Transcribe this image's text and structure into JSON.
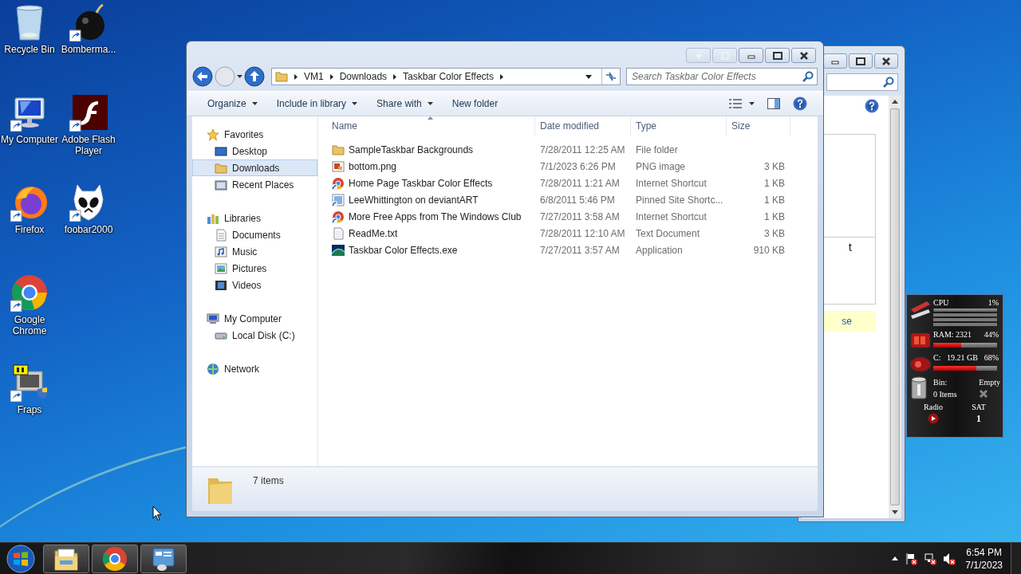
{
  "desktop_icons": [
    {
      "label": "Recycle Bin",
      "kind": "recycle"
    },
    {
      "label": "My Computer",
      "kind": "computer"
    },
    {
      "label": "Firefox",
      "kind": "firefox"
    },
    {
      "label": "Google Chrome",
      "kind": "chrome"
    },
    {
      "label": "Fraps",
      "kind": "fraps"
    },
    {
      "label": "Bomberma...",
      "kind": "bomb"
    },
    {
      "label": "Adobe Flash Player",
      "kind": "flash"
    },
    {
      "label": "foobar2000",
      "kind": "foobar"
    }
  ],
  "back_window": {
    "panel_text": "t",
    "notice_text": "se"
  },
  "explorer": {
    "breadcrumb": [
      "VM1",
      "Downloads",
      "Taskbar Color Effects"
    ],
    "search": {
      "placeholder": "Search Taskbar Color Effects"
    },
    "toolbar": [
      {
        "label": "Organize",
        "dropdown": true
      },
      {
        "label": "Include in library",
        "dropdown": true
      },
      {
        "label": "Share with",
        "dropdown": true
      },
      {
        "label": "New folder",
        "dropdown": false
      }
    ],
    "sidebar": [
      {
        "label": "Favorites",
        "kind": "star",
        "selected": false,
        "children": [
          {
            "label": "Desktop",
            "kind": "desktop",
            "selected": false
          },
          {
            "label": "Downloads",
            "kind": "downloads",
            "selected": true
          },
          {
            "label": "Recent Places",
            "kind": "recent",
            "selected": false
          }
        ]
      },
      {
        "label": "Libraries",
        "kind": "libraries",
        "selected": false,
        "children": [
          {
            "label": "Documents",
            "kind": "documents",
            "selected": false
          },
          {
            "label": "Music",
            "kind": "music",
            "selected": false
          },
          {
            "label": "Pictures",
            "kind": "pictures",
            "selected": false
          },
          {
            "label": "Videos",
            "kind": "videos",
            "selected": false
          }
        ]
      },
      {
        "label": "My Computer",
        "kind": "computer",
        "selected": false,
        "children": [
          {
            "label": "Local Disk (C:)",
            "kind": "disk",
            "selected": false
          }
        ]
      },
      {
        "label": "Network",
        "kind": "network",
        "selected": false
      }
    ],
    "columns": [
      "Name",
      "Date modified",
      "Type",
      "Size"
    ],
    "rows": [
      {
        "kind": "folder",
        "name": "SampleTaskbar Backgrounds",
        "date": "7/28/2011 12:25 AM",
        "type": "File folder"
      },
      {
        "kind": "image",
        "name": "bottom.png",
        "date": "7/1/2023 6:26 PM",
        "type": "PNG image",
        "size": "3 KB"
      },
      {
        "kind": "web",
        "name": "Home Page Taskbar Color Effects",
        "date": "7/28/2011 1:21 AM",
        "type": "Internet Shortcut",
        "size": "1 KB"
      },
      {
        "kind": "pinned",
        "name": "LeeWhittington on deviantART",
        "date": "6/8/2011 5:46 PM",
        "type": "Pinned Site Shortc...",
        "size": "1 KB"
      },
      {
        "kind": "web",
        "name": "More Free Apps from The Windows Club",
        "date": "7/27/2011 3:58 AM",
        "type": "Internet Shortcut",
        "size": "1 KB"
      },
      {
        "kind": "text",
        "name": "ReadMe.txt",
        "date": "7/28/2011 12:10 AM",
        "type": "Text Document",
        "size": "3 KB"
      },
      {
        "kind": "exe",
        "name": "Taskbar Color Effects.exe",
        "date": "7/27/2011 3:57 AM",
        "type": "Application",
        "size": "910 KB"
      }
    ],
    "status": "7 items"
  },
  "gadget": {
    "meters": [
      {
        "kind": "cpu",
        "label": "CPU",
        "reading": "1%",
        "level": 0.01
      },
      {
        "kind": "ram",
        "label": "RAM: 2321",
        "reading": "44%",
        "level": 0.44
      },
      {
        "kind": "disk",
        "label": "C:",
        "value": "19.21 GB",
        "reading": "68%",
        "level": 0.68
      }
    ],
    "bin": {
      "label": "Bin:",
      "status": "Empty",
      "count": "0 Items"
    },
    "radio": {
      "label": "Radio"
    },
    "day": {
      "label": "SAT",
      "date": "1"
    }
  },
  "taskbar": {
    "buttons": [
      {
        "kind": "explorer"
      },
      {
        "kind": "chrome"
      },
      {
        "kind": "app"
      }
    ],
    "clock": {
      "time": "6:54 PM",
      "date": "7/1/2023"
    }
  }
}
